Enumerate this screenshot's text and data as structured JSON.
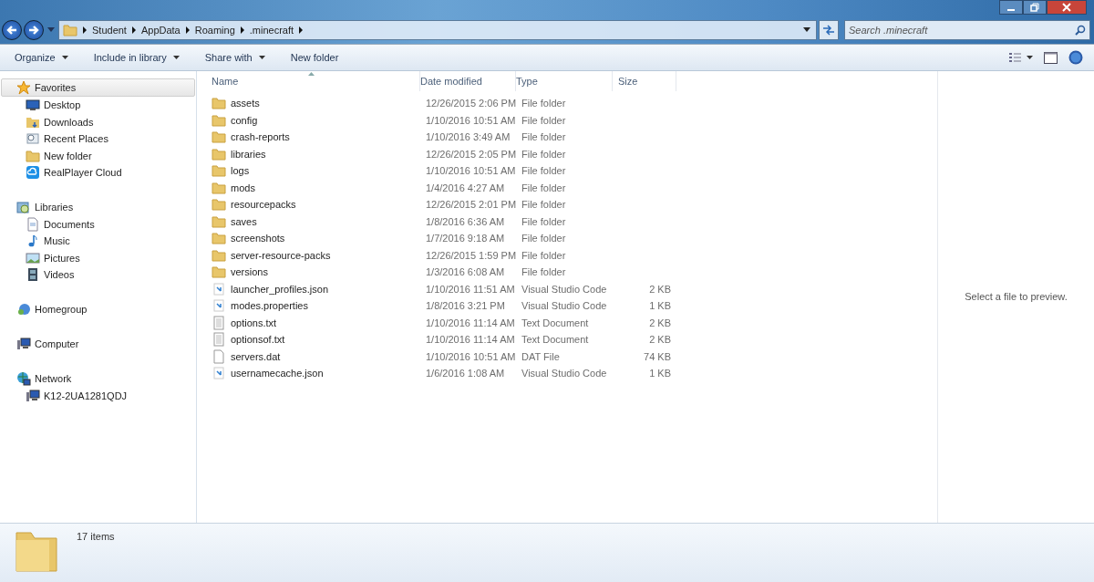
{
  "address_bar": {
    "crumbs": [
      "Student",
      "AppData",
      "Roaming",
      ".minecraft"
    ]
  },
  "search": {
    "placeholder": "Search .minecraft"
  },
  "toolbar": {
    "buttons": [
      {
        "label": "Organize",
        "dropdown": true
      },
      {
        "label": "Include in library",
        "dropdown": true
      },
      {
        "label": "Share with",
        "dropdown": true
      },
      {
        "label": "New folder",
        "dropdown": false
      }
    ]
  },
  "sidebar": {
    "groups": [
      {
        "label": "Favorites",
        "kind": "star",
        "selected": true,
        "children": [
          {
            "label": "Desktop",
            "kind": "desktop"
          },
          {
            "label": "Downloads",
            "kind": "downloads"
          },
          {
            "label": "Recent Places",
            "kind": "recent"
          },
          {
            "label": "New folder",
            "kind": "folder"
          },
          {
            "label": "RealPlayer Cloud",
            "kind": "cloud"
          }
        ]
      },
      {
        "label": "Libraries",
        "kind": "libraries",
        "selected": false,
        "children": [
          {
            "label": "Documents",
            "kind": "document"
          },
          {
            "label": "Music",
            "kind": "music"
          },
          {
            "label": "Pictures",
            "kind": "pictures"
          },
          {
            "label": "Videos",
            "kind": "videos"
          }
        ]
      },
      {
        "label": "Homegroup",
        "kind": "homegroup",
        "selected": false
      },
      {
        "label": "Computer",
        "kind": "computer",
        "selected": false
      },
      {
        "label": "Network",
        "kind": "network",
        "selected": false,
        "children": [
          {
            "label": "K12-2UA1281QDJ",
            "kind": "computer"
          }
        ]
      }
    ]
  },
  "file_list": {
    "columns": [
      "Name",
      "Date modified",
      "Type",
      "Size"
    ],
    "rows": [
      {
        "name": "assets",
        "date": "12/26/2015 2:06 PM",
        "type": "File folder",
        "kind": "folder"
      },
      {
        "name": "config",
        "date": "1/10/2016 10:51 AM",
        "type": "File folder",
        "kind": "folder"
      },
      {
        "name": "crash-reports",
        "date": "1/10/2016 3:49 AM",
        "type": "File folder",
        "kind": "folder"
      },
      {
        "name": "libraries",
        "date": "12/26/2015 2:05 PM",
        "type": "File folder",
        "kind": "folder"
      },
      {
        "name": "logs",
        "date": "1/10/2016 10:51 AM",
        "type": "File folder",
        "kind": "folder"
      },
      {
        "name": "mods",
        "date": "1/4/2016 4:27 AM",
        "type": "File folder",
        "kind": "folder"
      },
      {
        "name": "resourcepacks",
        "date": "12/26/2015 2:01 PM",
        "type": "File folder",
        "kind": "folder"
      },
      {
        "name": "saves",
        "date": "1/8/2016 6:36 AM",
        "type": "File folder",
        "kind": "folder"
      },
      {
        "name": "screenshots",
        "date": "1/7/2016 9:18 AM",
        "type": "File folder",
        "kind": "folder"
      },
      {
        "name": "server-resource-packs",
        "date": "12/26/2015 1:59 PM",
        "type": "File folder",
        "kind": "folder"
      },
      {
        "name": "versions",
        "date": "1/3/2016 6:08 AM",
        "type": "File folder",
        "kind": "folder"
      },
      {
        "name": "launcher_profiles.json",
        "date": "1/10/2016 11:51 AM",
        "type": "Visual Studio Code",
        "size": "2 KB",
        "kind": "code"
      },
      {
        "name": "modes.properties",
        "date": "1/8/2016 3:21 PM",
        "type": "Visual Studio Code",
        "size": "1 KB",
        "kind": "code"
      },
      {
        "name": "options.txt",
        "date": "1/10/2016 11:14 AM",
        "type": "Text Document",
        "size": "2 KB",
        "kind": "text"
      },
      {
        "name": "optionsof.txt",
        "date": "1/10/2016 11:14 AM",
        "type": "Text Document",
        "size": "2 KB",
        "kind": "text"
      },
      {
        "name": "servers.dat",
        "date": "1/10/2016 10:51 AM",
        "type": "DAT File",
        "size": "74 KB",
        "kind": "blank"
      },
      {
        "name": "usernamecache.json",
        "date": "1/6/2016 1:08 AM",
        "type": "Visual Studio Code",
        "size": "1 KB",
        "kind": "code"
      }
    ]
  },
  "preview_pane": {
    "message": "Select a file to preview."
  },
  "details_pane": {
    "item_count": "17 items"
  }
}
